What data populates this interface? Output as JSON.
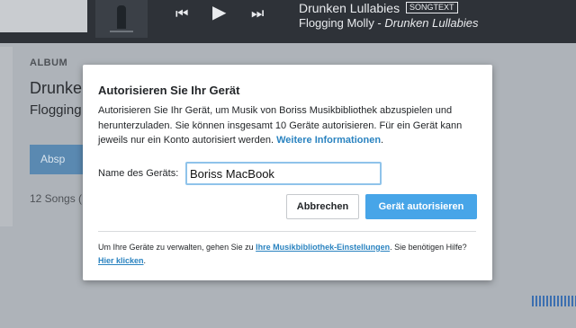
{
  "player": {
    "track_title": "Drunken Lullabies",
    "track_badge": "SONGTEXT",
    "artist": "Flogging Molly -",
    "album": "Drunken Lullabies",
    "prev_icon": "⏮",
    "play_icon": "▶",
    "next_icon": "⏭"
  },
  "page": {
    "album_label": "ALBUM",
    "album_title": "Drunken",
    "album_artist": "Flogging",
    "play_label": "Absp",
    "song_count": "12 Songs ("
  },
  "modal": {
    "title": "Autorisieren Sie Ihr Gerät",
    "description": "Autorisieren Sie Ihr Gerät, um Musik von Boriss Musikbibliothek abzuspielen und herunterzuladen. Sie können insgesamt 10 Geräte autorisieren. Für ein Gerät kann jeweils nur ein Konto autorisiert werden.",
    "more_info_link": "Weitere Informationen",
    "more_info_suffix": ".",
    "field_label": "Name des Geräts:",
    "device_name_value": "Boriss MacBook",
    "cancel_label": "Abbrechen",
    "authorize_label": "Gerät autorisieren",
    "footer_text_1": "Um Ihre Geräte zu verwalten, gehen Sie zu",
    "footer_link_1": "Ihre Musikbibliothek-Einstellungen",
    "footer_text_2": ". Sie benötigen Hilfe?",
    "footer_link_2": "Hier klicken",
    "footer_text_3": "."
  },
  "colors": {
    "accent": "#47a5e8",
    "link": "#2a83c0",
    "player_bg": "#2e3238"
  }
}
